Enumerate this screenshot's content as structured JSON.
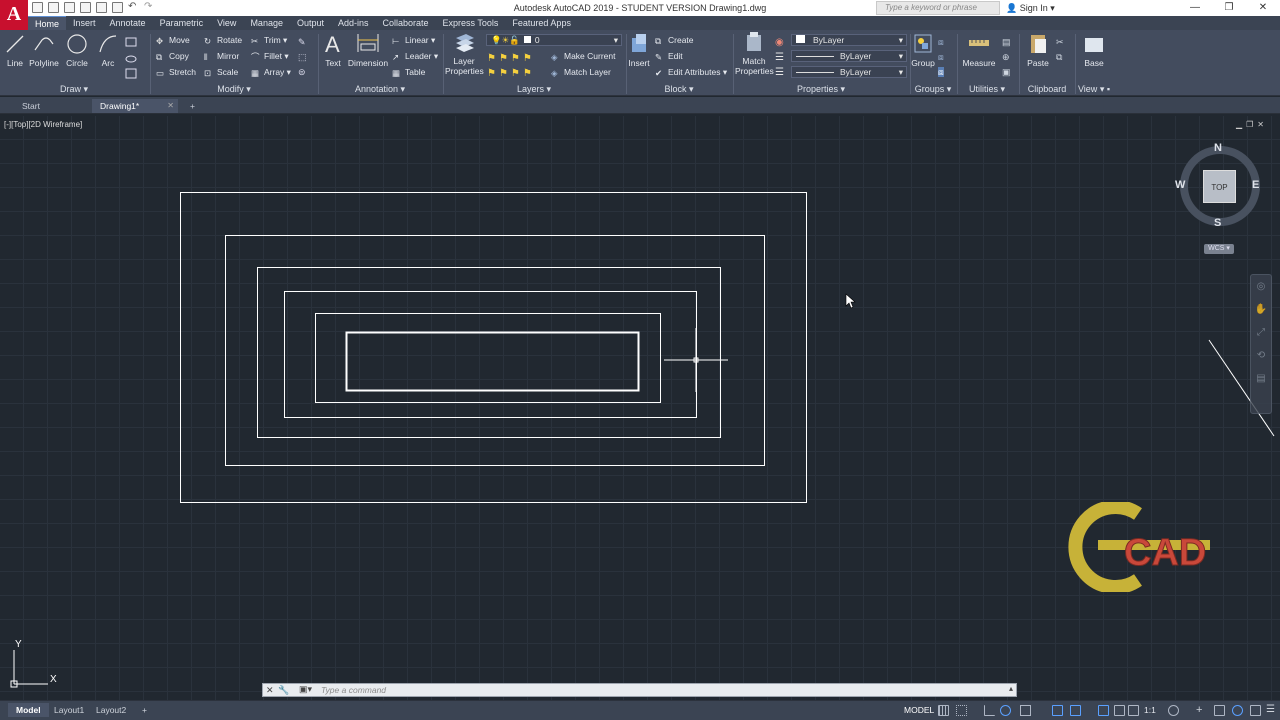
{
  "window": {
    "title": "Autodesk AutoCAD 2019 - STUDENT VERSION    Drawing1.dwg",
    "search_placeholder": "Type a keyword or phrase",
    "sign_in": "Sign In",
    "logo_letter": "A"
  },
  "ribbon_tabs": [
    "Home",
    "Insert",
    "Annotate",
    "Parametric",
    "View",
    "Manage",
    "Output",
    "Add-ins",
    "Collaborate",
    "Express Tools",
    "Featured Apps"
  ],
  "ribbon": {
    "draw": {
      "title": "Draw",
      "line": "Line",
      "polyline": "Polyline",
      "circle": "Circle",
      "arc": "Arc"
    },
    "modify": {
      "title": "Modify",
      "move": "Move",
      "rotate": "Rotate",
      "trim": "Trim",
      "copy": "Copy",
      "mirror": "Mirror",
      "fillet": "Fillet",
      "stretch": "Stretch",
      "scale": "Scale",
      "array": "Array"
    },
    "annotation": {
      "title": "Annotation",
      "text": "Text",
      "dimension": "Dimension",
      "linear": "Linear",
      "leader": "Leader",
      "table": "Table"
    },
    "layers": {
      "title": "Layers",
      "layer_properties": "Layer Properties",
      "current_layer": "0",
      "make_current": "Make Current",
      "match_layer": "Match Layer"
    },
    "block": {
      "title": "Block",
      "insert": "Insert",
      "create": "Create",
      "edit": "Edit",
      "edit_attributes": "Edit Attributes"
    },
    "properties": {
      "title": "Properties",
      "match_properties": "Match Properties",
      "color": "ByLayer",
      "linetype": "ByLayer",
      "lineweight": "ByLayer"
    },
    "groups": {
      "title": "Groups",
      "group": "Group"
    },
    "utilities": {
      "title": "Utilities",
      "measure": "Measure"
    },
    "clipboard": {
      "title": "Clipboard",
      "paste": "Paste"
    },
    "view": {
      "title": "View",
      "base": "Base"
    }
  },
  "doc_tabs": {
    "start": "Start",
    "drawing": "Drawing1*"
  },
  "viewport": {
    "label": "[-][Top][2D Wireframe]"
  },
  "viewcube": {
    "north": "N",
    "south": "S",
    "east": "E",
    "west": "W",
    "face": "TOP",
    "wcs": "WCS"
  },
  "ucs": {
    "x": "X",
    "y": "Y"
  },
  "watermark": "CAD",
  "command": {
    "placeholder": "Type a command"
  },
  "status": {
    "tabs": [
      "Model",
      "Layout1",
      "Layout2"
    ],
    "model_label": "MODEL",
    "scale": "1:1"
  },
  "colors": {
    "background": "#212830",
    "ribbon": "#434c5e",
    "accent": "#c8102e"
  }
}
